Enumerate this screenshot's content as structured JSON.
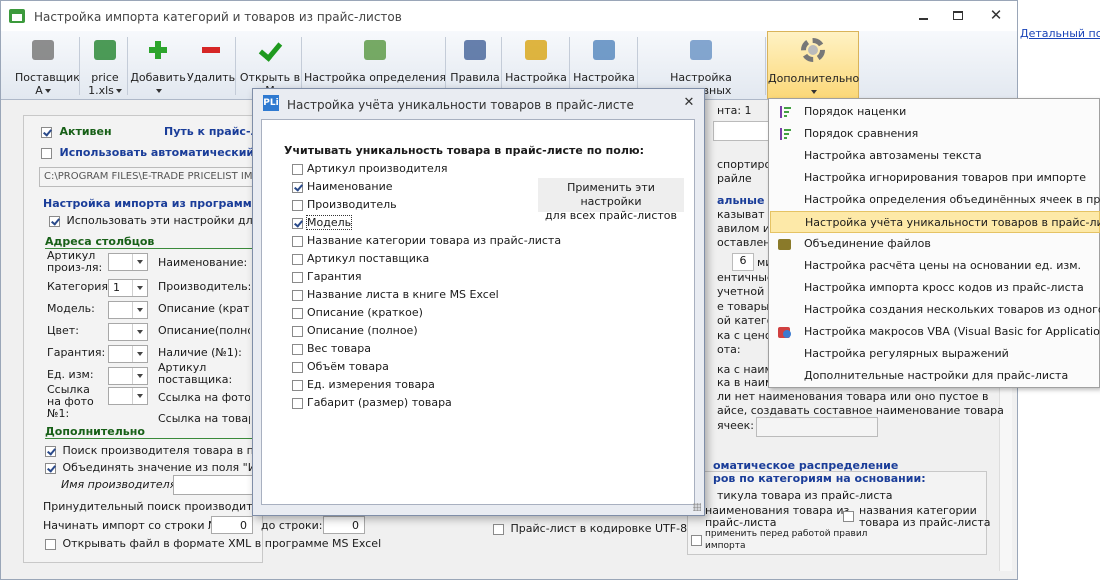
{
  "window": {
    "title": "Настройка импорта категорий и товаров из прайс-листов"
  },
  "right_link": "Детальный поиск",
  "ribbon": [
    {
      "label1": "Поставщик",
      "label2": "А",
      "icon": "truck-icon",
      "dd": true
    },
    {
      "label1": "price",
      "label2": "1.xls",
      "icon": "excel-icon",
      "dd": true
    },
    {
      "label1": "Добавить",
      "label2": "",
      "icon": "plus-icon",
      "dd": true
    },
    {
      "label1": "Удалить",
      "label2": "",
      "icon": "minus-icon",
      "dd": false
    },
    {
      "label1": "Открыть в",
      "label2": "M",
      "icon": "check-icon",
      "dd": false
    },
    {
      "label1": "Настройка определения",
      "label2": "",
      "icon": "settings-sheet-icon",
      "dd": false
    },
    {
      "label1": "Правила",
      "label2": "",
      "icon": "quill-icon",
      "dd": false
    },
    {
      "label1": "Настройка",
      "label2": "",
      "icon": "coins-icon",
      "dd": false
    },
    {
      "label1": "Настройка",
      "label2": "",
      "icon": "cart-icon",
      "dd": false
    },
    {
      "label1": "Настройка составных",
      "label2": "",
      "icon": "hand-icon",
      "dd": false
    },
    {
      "label1": "Дополнительно",
      "label2": "",
      "icon": "gear-icon",
      "dd": true
    }
  ],
  "main": {
    "active": "Активен",
    "path_label": "Путь к прайс-л",
    "auto_label": "Использовать автоматический им",
    "path_value": "C:\\PROGRAM FILES\\E-TRADE PRICELIST IM",
    "import_settings_title": "Настройка импорта из программы М",
    "use_settings": "Использовать эти настройки для все",
    "columns_title": "Адреса столбцов",
    "fields_left": [
      {
        "label": "Артикул произ-ля:",
        "value": ""
      },
      {
        "label": "Категория:",
        "value": "1"
      },
      {
        "label": "Модель:",
        "value": ""
      },
      {
        "label": "Цвет:",
        "value": ""
      },
      {
        "label": "Гарантия:",
        "value": ""
      },
      {
        "label": "Ед. изм:",
        "value": ""
      },
      {
        "label": "Ссылка на фото №1:",
        "value": ""
      }
    ],
    "fields_mid": [
      "Наименование:",
      "Производитель:",
      "Описание (краткое",
      "Описание(полное)",
      "Наличие (№1):",
      "Артикул поставщика:",
      "Ссылка на фото №",
      "Ссылка на товар:"
    ],
    "extra_title": "Дополнительно",
    "search_maker": "Поиск производителя товара в прайс-",
    "merge_value": "Объединять значение из поля \"Имя пр",
    "maker_name": "Имя производителя:",
    "forced_search": "Принудительный поиск производителя в",
    "start_row_label": "Начинать импорт со строки №:",
    "start_row": "0",
    "to_row_label": "до строки:",
    "to_row": "0",
    "open_xml": "Открывать файл в формате XML в программе MS Excel",
    "utf8": "Прайс-лист в кодировке UTF-8"
  },
  "right_panel": {
    "kinta": "нта: 1",
    "lines": [
      "спортирова",
      "райле",
      "альные н",
      "казыват",
      "авилом им",
      "оставлен",
      "мин.",
      "ентичные",
      "учетной си",
      "е товары в",
      "ой катего",
      "ка с ценой",
      "ота:",
      "ка с наиме",
      "ка в наим"
    ],
    "num6": "6",
    "long1": "ли нет наименования товара или оно пустое в",
    "long2": "айсе, создавать составное наименование товара",
    "long3": "ячеек:",
    "auto_title1": "оматическое распределение",
    "auto_title2": "ров по категориям на основании:",
    "opt_article": "тикула товара из прайс-листа",
    "opt_name1": "наименования товара из",
    "opt_name2": "прайс-листа",
    "opt_cat1": "названия  категории",
    "opt_cat2": "товара из прайс-листа",
    "opt_apply1": "применить перед работой правил",
    "opt_apply2": "импорта"
  },
  "menu": {
    "items": [
      {
        "label": "Порядок наценки",
        "icon": "sort-icon"
      },
      {
        "label": "Порядок сравнения",
        "icon": "sort-icon"
      },
      {
        "label": "Настройка автозамены текста",
        "icon": ""
      },
      {
        "label": "Настройка игнорирования товаров при импорте",
        "icon": ""
      },
      {
        "label": "Настройка определения объединённых ячеек в прайс-л",
        "icon": ""
      },
      {
        "label": "Настройка учёта уникальности товаров в прайс-листе",
        "icon": "",
        "hl": true
      },
      {
        "label": "Объединение файлов",
        "icon": "files-icon"
      },
      {
        "label": "Настройка расчёта цены на основании ед. изм.",
        "icon": ""
      },
      {
        "label": "Настройка импорта кросс кодов из прайс-листа",
        "icon": ""
      },
      {
        "label": "Настройка создания нескольких товаров из одного то",
        "icon": ""
      },
      {
        "label": "Настройка макросов VBA (Visual Basic for Applications)",
        "icon": "vba-icon"
      },
      {
        "label": "Настройка регулярных выражений",
        "icon": ""
      },
      {
        "label": "Дополнительные настройки для прайс-листа",
        "icon": ""
      }
    ]
  },
  "dialog": {
    "title": "Настройка учёта уникальности товаров в прайс-листе",
    "heading": "Учитывать уникальность товара в прайс-листе по полю:",
    "apply_btn1": "Применить эти настройки",
    "apply_btn2": "для всех прайс-листов",
    "options": [
      {
        "label": "Артикул производителя",
        "checked": false
      },
      {
        "label": "Наименование",
        "checked": true
      },
      {
        "label": "Производитель",
        "checked": false
      },
      {
        "label": "Модель",
        "checked": true
      },
      {
        "label": "Название категории товара из прайс-листа",
        "checked": false
      },
      {
        "label": "Артикул поставщика",
        "checked": false
      },
      {
        "label": "Гарантия",
        "checked": false
      },
      {
        "label": "Название листа в книге MS Excel",
        "checked": false
      },
      {
        "label": "Описание (краткое)",
        "checked": false
      },
      {
        "label": "Описание (полное)",
        "checked": false
      },
      {
        "label": "Вес товара",
        "checked": false
      },
      {
        "label": "Объём товара",
        "checked": false
      },
      {
        "label": "Ед. измерения товара",
        "checked": false
      },
      {
        "label": "Габарит (размер) товара",
        "checked": false
      }
    ]
  }
}
